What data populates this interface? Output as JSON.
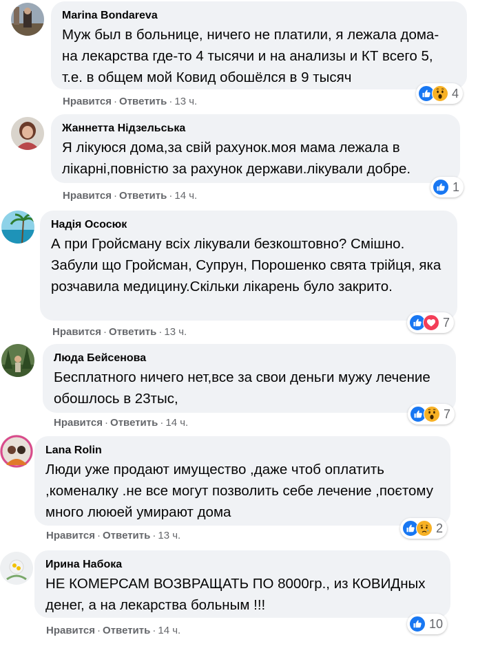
{
  "actions": {
    "like": "Нравится",
    "reply": "Ответить",
    "dot": "·"
  },
  "colors": {
    "bubble": "#f0f2f5",
    "like_blue": "#1877f2",
    "love_red": "#f33e58",
    "wow_yellow": "#f7b125"
  },
  "comments": [
    {
      "author": "Marina Bondareva",
      "text": "Муж был в больнице, ничего не платили, я лежала дома- на лекарства где-то 4 тысячи и на анализы и КТ всего 5, т.е. в общем мой Ковид обошёлся в 9 тысяч",
      "time": "13 ч.",
      "reactions": [
        "like-icon",
        "wow-icon"
      ],
      "reaction_count": "4"
    },
    {
      "author": "Жаннетта Нідзельська",
      "text": "Я лікуюся дома,за свій рахунок.моя мама лежала в лікарні,повністю за рахунок держави.лікували добре.",
      "time": "14 ч.",
      "reactions": [
        "like-icon"
      ],
      "reaction_count": "1"
    },
    {
      "author": "Надія Ососюк",
      "text": "А при Гройсману всіх лікували безкоштовно? Смішно. Забули що Гройсман, Супрун, Порошенко свята трійця, яка розчавила медицину.Скільки лікарень було закрито.",
      "time": "13 ч.",
      "reactions": [
        "like-icon",
        "love-icon"
      ],
      "reaction_count": "7"
    },
    {
      "author": "Люда Бейсенова",
      "text": "Бесплатного ничего нет,все за свои деньги мужу лечение обошлось в 23тыс,",
      "time": "14 ч.",
      "reactions": [
        "like-icon",
        "wow-icon"
      ],
      "reaction_count": "7"
    },
    {
      "author": "Lana Rolin",
      "text": "Люди уже продают имущество ,даже чтоб оплатить ,коменалку .не все могут позволить себе лечение ,поєтому много лююей умирают дома",
      "time": "13 ч.",
      "reactions": [
        "like-icon",
        "sad-icon"
      ],
      "reaction_count": "2"
    },
    {
      "author": "Ирина Набока",
      "text": "НЕ КОМЕРСАМ ВОЗВРАЩАТЬ ПО 8000гр., из КОВИДных денег, а на лекарства больным !!!",
      "time": "14 ч.",
      "reactions": [
        "like-icon"
      ],
      "reaction_count": "10"
    }
  ]
}
